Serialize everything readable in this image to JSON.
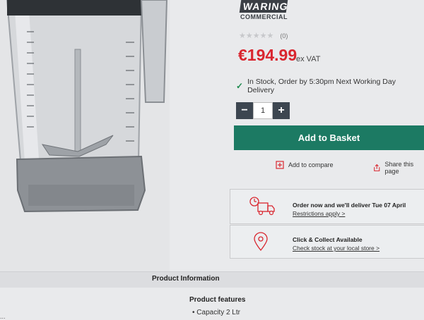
{
  "brand": {
    "name": "WARING",
    "sub": "COMMERCIAL"
  },
  "rating": {
    "stars": "★★★★★",
    "count": "(0)",
    "value": 0,
    "max": 5
  },
  "price": {
    "amount": "€194.99",
    "vat_note": "ex VAT"
  },
  "stock": {
    "text": "In Stock, Order by 5:30pm Next Working Day Delivery"
  },
  "quantity": {
    "minus": "−",
    "value": "1",
    "plus": "+"
  },
  "buttons": {
    "add_to_basket": "Add to Basket",
    "add_to_compare": "Add to compare",
    "share": "Share this page"
  },
  "delivery": {
    "title": "Order now and we'll deliver Tue 07 April",
    "link": "Restrictions apply >"
  },
  "collect": {
    "title": "Click & Collect Available",
    "link": "Check stock at your local store >"
  },
  "info": {
    "band_title": "Product Information",
    "features_title": "Product features",
    "features": [
      "Capacity 2 Ltr"
    ],
    "partial_left": "..."
  },
  "colors": {
    "price": "#d9262f",
    "basket": "#1c7a63",
    "stock_tick": "#1d8a4e",
    "icon_red": "#d9262f"
  }
}
